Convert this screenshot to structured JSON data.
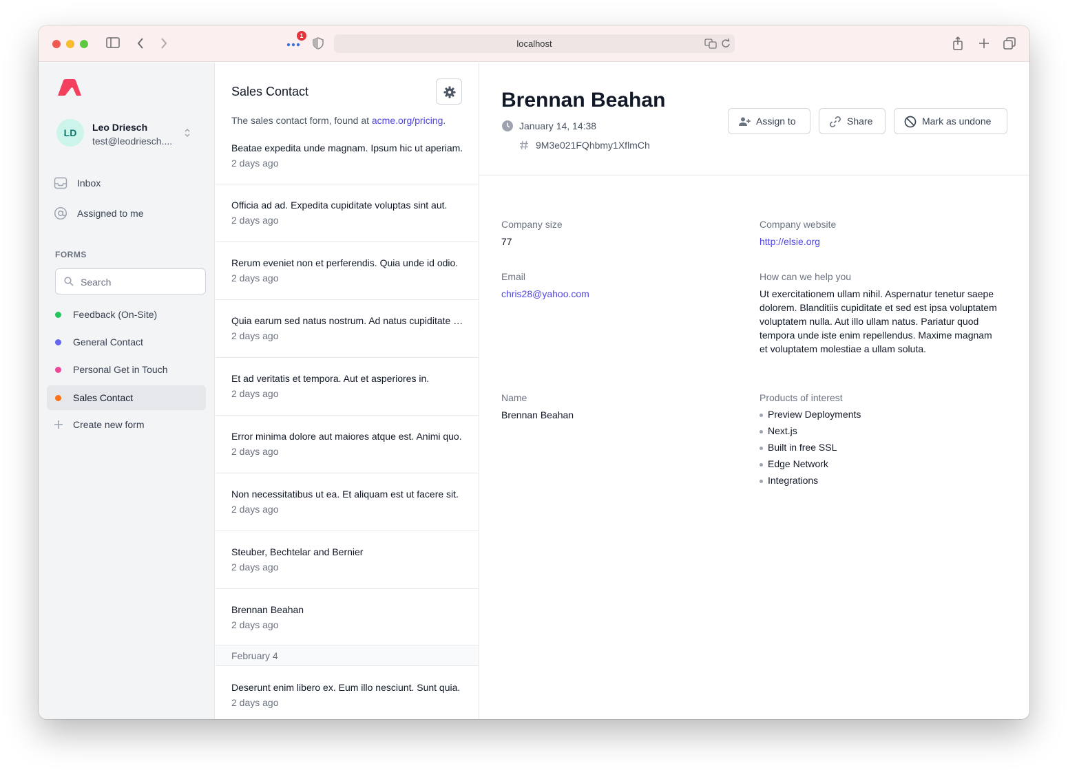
{
  "browser": {
    "url": "localhost",
    "badge_count": "1"
  },
  "colors": {
    "accent": "#4f46e5",
    "logo": "#f43f5e",
    "feedback_dot": "#22c55e",
    "general_dot": "#6366f1",
    "personal_dot": "#ec4899",
    "sales_dot": "#f97316"
  },
  "user": {
    "initials": "LD",
    "name": "Leo Driesch",
    "email": "test@leodriesch...."
  },
  "nav": {
    "inbox": "Inbox",
    "assigned": "Assigned to me"
  },
  "forms_section": {
    "label": "FORMS",
    "search_placeholder": "Search",
    "items": [
      {
        "label": "Feedback (On-Site)"
      },
      {
        "label": "General Contact"
      },
      {
        "label": "Personal Get in Touch"
      },
      {
        "label": "Sales Contact"
      }
    ],
    "create_label": "Create new form"
  },
  "list": {
    "title": "Sales Contact",
    "desc_prefix": "The sales contact form, found at ",
    "desc_link": "acme.org/pricing",
    "desc_suffix": ".",
    "entries": [
      {
        "title": "Beatae expedita unde magnam. Ipsum hic ut aperiam.",
        "date": "2 days ago"
      },
      {
        "title": "Officia ad ad. Expedita cupiditate voluptas sint aut.",
        "date": "2 days ago"
      },
      {
        "title": "Rerum eveniet non et perferendis. Quia unde id odio.",
        "date": "2 days ago"
      },
      {
        "title": "Quia earum sed natus nostrum. Ad natus cupiditate et.",
        "date": "2 days ago"
      },
      {
        "title": "Et ad veritatis et tempora. Aut et asperiores in.",
        "date": "2 days ago"
      },
      {
        "title": "Error minima dolore aut maiores atque est. Animi quo.",
        "date": "2 days ago"
      },
      {
        "title": "Non necessitatibus ut ea. Et aliquam est ut facere sit.",
        "date": "2 days ago"
      },
      {
        "title": "Steuber, Bechtelar and Bernier",
        "date": "2 days ago"
      },
      {
        "title": "Brennan Beahan",
        "date": "2 days ago"
      }
    ],
    "date_separator": "February 4",
    "last_entry": {
      "title": "Deserunt enim libero ex. Eum illo nesciunt. Sunt quia.",
      "date": "2 days ago"
    }
  },
  "detail": {
    "name": "Brennan Beahan",
    "date": "January 14, 14:38",
    "id": "9M3e021FQhbmy1XflmCh",
    "buttons": {
      "assign": "Assign to",
      "share": "Share",
      "undone": "Mark as undone"
    },
    "fields": {
      "company_size_label": "Company size",
      "company_size": "77",
      "website_label": "Company website",
      "website": "http://elsie.org",
      "email_label": "Email",
      "email": "chris28@yahoo.com",
      "help_label": "How can we help you",
      "help": "Ut exercitationem ullam nihil. Aspernatur tenetur saepe dolorem. Blanditiis cupiditate et sed est ipsa voluptatem voluptatem nulla. Aut illo ullam natus. Pariatur quod tempora unde iste enim repellendus. Maxime magnam et voluptatem molestiae a ullam soluta.",
      "name_label": "Name",
      "name": "Brennan Beahan",
      "products_label": "Products of interest",
      "products": [
        "Preview Deployments",
        "Next.js",
        "Built in free SSL",
        "Edge Network",
        "Integrations"
      ]
    }
  }
}
